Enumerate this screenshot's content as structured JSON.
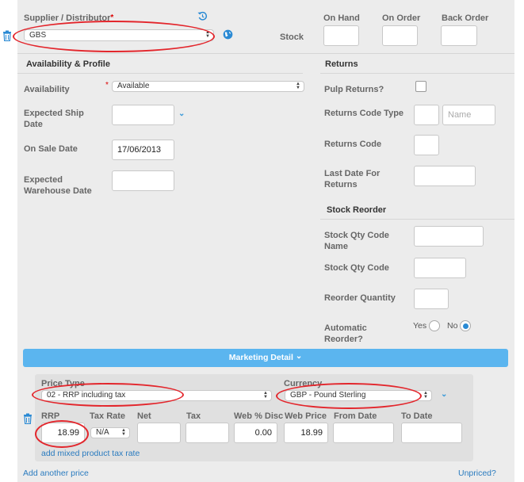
{
  "supplier": {
    "label": "Supplier / Distributor",
    "required_mark": "*",
    "value": "GBS",
    "stock_label": "Stock"
  },
  "stock": {
    "on_hand_label": "On Hand",
    "on_order_label": "On Order",
    "back_order_label": "Back Order",
    "on_hand_value": "",
    "on_order_value": "",
    "back_order_value": ""
  },
  "availability": {
    "section_title": "Availability & Profile",
    "availability_label": "Availability",
    "required_mark": "*",
    "availability_value": "Available",
    "expected_ship_date_label": "Expected Ship Date",
    "expected_ship_date_value": "",
    "on_sale_date_label": "On Sale Date",
    "on_sale_date_value": "17/06/2013",
    "expected_warehouse_date_label": "Expected Warehouse Date",
    "expected_warehouse_date_value": ""
  },
  "returns": {
    "section_title": "Returns",
    "pulp_returns_label": "Pulp Returns?",
    "returns_code_type_label": "Returns Code Type",
    "returns_code_type_value": "",
    "name_placeholder": "Name",
    "returns_code_label": "Returns Code",
    "last_date_label": "Last Date For Returns"
  },
  "stock_reorder": {
    "section_title": "Stock Reorder",
    "stock_qty_code_name_label": "Stock Qty Code Name",
    "stock_qty_code_label": "Stock Qty Code",
    "reorder_quantity_label": "Reorder Quantity",
    "automatic_reorder_label": "Automatic Reorder?",
    "yes_label": "Yes",
    "no_label": "No",
    "automatic_reorder_selected": "No"
  },
  "marketing": {
    "title": "Marketing Detail",
    "chevron": "⌄"
  },
  "price": {
    "price_type_label": "Price Type",
    "price_type_value": "02 - RRP including tax",
    "currency_label": "Currency",
    "currency_value": "GBP - Pound Sterling",
    "rrp_label": "RRP",
    "rrp_value": "18.99",
    "tax_rate_label": "Tax Rate",
    "tax_rate_value": "N/A",
    "net_label": "Net",
    "tax_label": "Tax",
    "web_disc_label": "Web % Disc",
    "web_disc_value": "0.00",
    "web_price_label": "Web Price",
    "web_price_value": "18.99",
    "from_date_label": "From Date",
    "to_date_label": "To Date",
    "mixed_tax_link": "add mixed product tax rate"
  },
  "footer": {
    "add_price_link": "Add another price",
    "unpriced_link": "Unpriced?"
  },
  "colors": {
    "accent": "#5bb5ef",
    "link": "#2a7bbf",
    "annotation": "#e3262c"
  }
}
